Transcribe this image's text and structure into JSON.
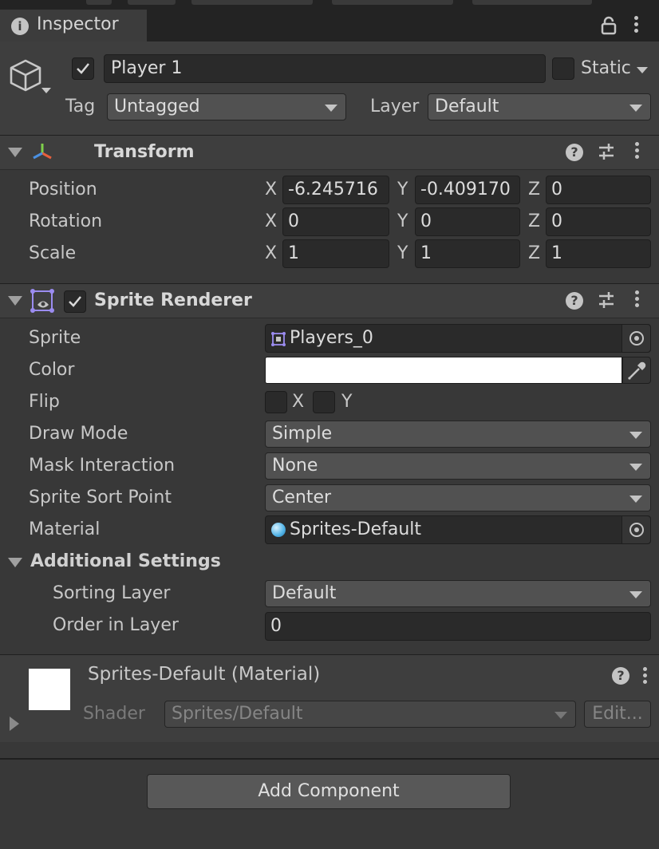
{
  "tab": {
    "label": "Inspector"
  },
  "gameobject": {
    "active": true,
    "name": "Player 1",
    "static_label": "Static",
    "static_checked": false,
    "tag_label": "Tag",
    "tag_value": "Untagged",
    "layer_label": "Layer",
    "layer_value": "Default"
  },
  "transform": {
    "title": "Transform",
    "position": {
      "label": "Position",
      "x": "-6.245716",
      "y": "-0.409170",
      "z": "0"
    },
    "rotation": {
      "label": "Rotation",
      "x": "0",
      "y": "0",
      "z": "0"
    },
    "scale": {
      "label": "Scale",
      "x": "1",
      "y": "1",
      "z": "1"
    },
    "axis_x": "X",
    "axis_y": "Y",
    "axis_z": "Z"
  },
  "sprite_renderer": {
    "title": "Sprite Renderer",
    "enabled": true,
    "sprite_label": "Sprite",
    "sprite_value": "Players_0",
    "color_label": "Color",
    "color_value": "#ffffff",
    "flip_label": "Flip",
    "flip_x": "X",
    "flip_y": "Y",
    "draw_mode_label": "Draw Mode",
    "draw_mode_value": "Simple",
    "mask_label": "Mask Interaction",
    "mask_value": "None",
    "sort_point_label": "Sprite Sort Point",
    "sort_point_value": "Center",
    "material_label": "Material",
    "material_value": "Sprites-Default",
    "additional_label": "Additional Settings",
    "sorting_layer_label": "Sorting Layer",
    "sorting_layer_value": "Default",
    "order_label": "Order in Layer",
    "order_value": "0"
  },
  "material": {
    "title": "Sprites-Default (Material)",
    "shader_label": "Shader",
    "shader_value": "Sprites/Default",
    "edit_label": "Edit..."
  },
  "add_component": {
    "label": "Add Component"
  },
  "icons": [
    "info-icon",
    "lock-icon",
    "kebab-menu-icon",
    "gameobject-cube-icon",
    "transform-icon",
    "help-icon",
    "preset-sliders-icon",
    "sprite-renderer-icon",
    "object-picker-icon",
    "eyedropper-icon",
    "material-sphere-icon"
  ]
}
